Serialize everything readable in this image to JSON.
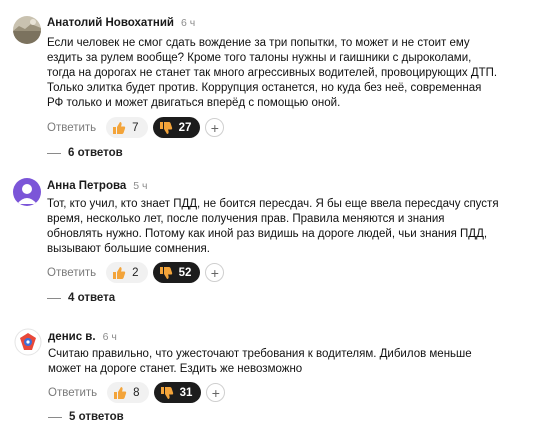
{
  "comments": [
    {
      "author": "Анатолий Новохатний",
      "time": "6 ч",
      "lines": [
        "Если человек не смог сдать вождение за три попытки, то может и не стоит ему",
        "ездить за рулем вообще? Кроме того талоны нужны и гаишники с дыроколами,",
        "тогда на дорогах не станет так много агрессивных водителей, провоцирующих ДТП.",
        "Только элитка будет против. Коррупция останется, но куда без неё, современная",
        "РФ только и может двигаться вперёд с помощью оной."
      ],
      "reply_label": "Ответить",
      "likes": "7",
      "dislikes": "27",
      "replies_label": "6 ответов"
    },
    {
      "author": "Анна Петрова",
      "time": "5 ч",
      "lines": [
        "Тот, кто учил, кто знает ПДД, не боится пересдач. Я бы еще ввела пересдачу спустя",
        "время, несколько лет, после получения прав. Правила меняются и знания",
        "обновлять нужно. Потому как иной раз видишь на дороге людей, чьи знания ПДД,",
        "вызывают большие сомнения."
      ],
      "reply_label": "Ответить",
      "likes": "2",
      "dislikes": "52",
      "replies_label": "4 ответа"
    },
    {
      "author": "денис в.",
      "time": "6 ч",
      "lines": [
        "Считаю правильно, что ужесточают требования к водителям. Дибилов меньше",
        "может на дороге станет. Ездить же невозможно"
      ],
      "reply_label": "Ответить",
      "likes": "8",
      "dislikes": "31",
      "replies_label": "5 ответов"
    }
  ],
  "icons": {
    "like": "thumbs-up-icon",
    "dislike": "thumbs-down-icon",
    "add_reaction": "plus-icon"
  },
  "colors": {
    "dislike_pill": "#1c1c1c",
    "like_pill": "#f1f1f1",
    "thumb": "#f3a43a"
  }
}
